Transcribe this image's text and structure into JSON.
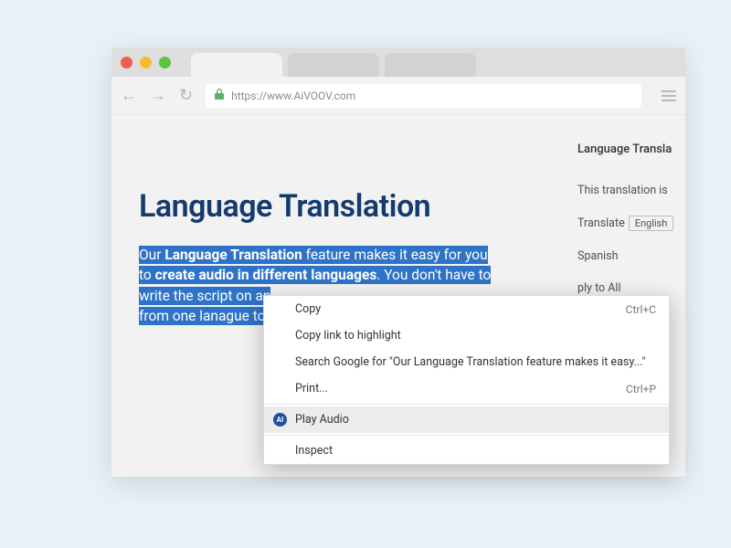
{
  "browser": {
    "url": "https://www.AiVOOV.com"
  },
  "page": {
    "title": "Language Translation",
    "p_before_strong1": "Our ",
    "strong1": "Language Translation",
    "p_mid1": " feature makes it easy for you to ",
    "strong2": "create audio in different languages",
    "p_mid2": ". You don't have to write the script on an",
    "p_tail_line4": "from one lanague to"
  },
  "side": {
    "header": "Language Transla",
    "line1": "This translation is",
    "translate_label": "Translate",
    "lang_chip": "English",
    "spanish": "Spanish",
    "apply": "ply to All"
  },
  "ctx": {
    "copy": "Copy",
    "copy_sc": "Ctrl+C",
    "copy_link": "Copy link to highlight",
    "search": "Search Google for \"Our Language Translation feature makes it easy...\"",
    "print": "Print...",
    "print_sc": "Ctrl+P",
    "play_audio": "Play Audio",
    "play_icon": "AI",
    "inspect": "Inspect"
  }
}
